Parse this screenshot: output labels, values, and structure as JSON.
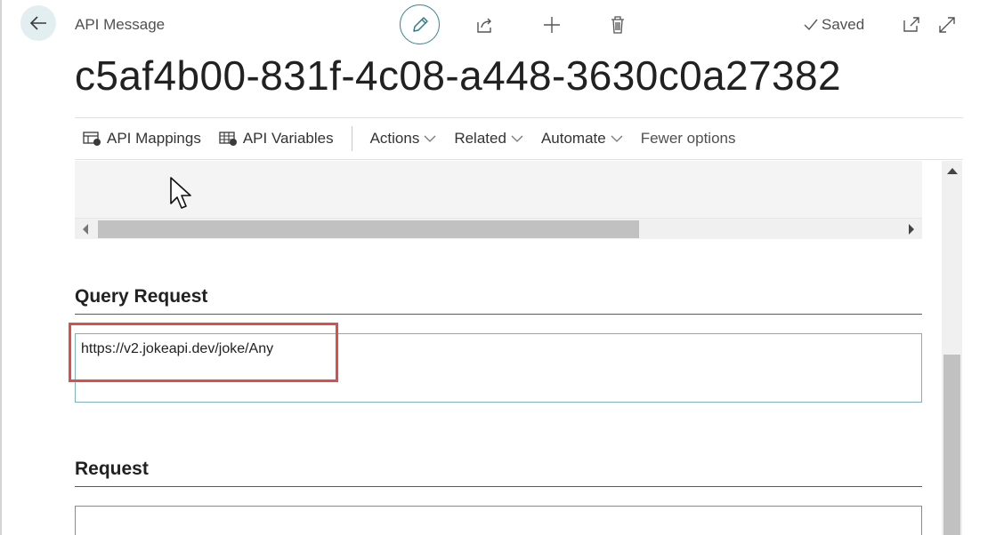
{
  "header": {
    "caption": "API Message",
    "title": "c5af4b00-831f-4c08-a448-3630c0a27382",
    "status": "Saved"
  },
  "toolbar": {
    "back": "back-arrow-icon",
    "edit": "pencil-icon",
    "share": "share-icon",
    "new": "plus-icon",
    "delete": "trash-icon",
    "open_new_window": "open-in-new-window-icon",
    "expand": "expand-icon"
  },
  "actionbar": {
    "items": [
      {
        "label": "API Mappings",
        "icon": "api-mappings-icon"
      },
      {
        "label": "API Variables",
        "icon": "api-variables-icon"
      }
    ],
    "menus": [
      {
        "label": "Actions"
      },
      {
        "label": "Related"
      },
      {
        "label": "Automate"
      }
    ],
    "fewer_options": "Fewer options"
  },
  "sections": {
    "query_request": {
      "title": "Query Request",
      "value": "https://v2.jokeapi.dev/joke/Any"
    },
    "request": {
      "title": "Request",
      "value": ""
    }
  },
  "colors": {
    "accent": "#3d8a96",
    "highlight": "#e04b4b"
  }
}
